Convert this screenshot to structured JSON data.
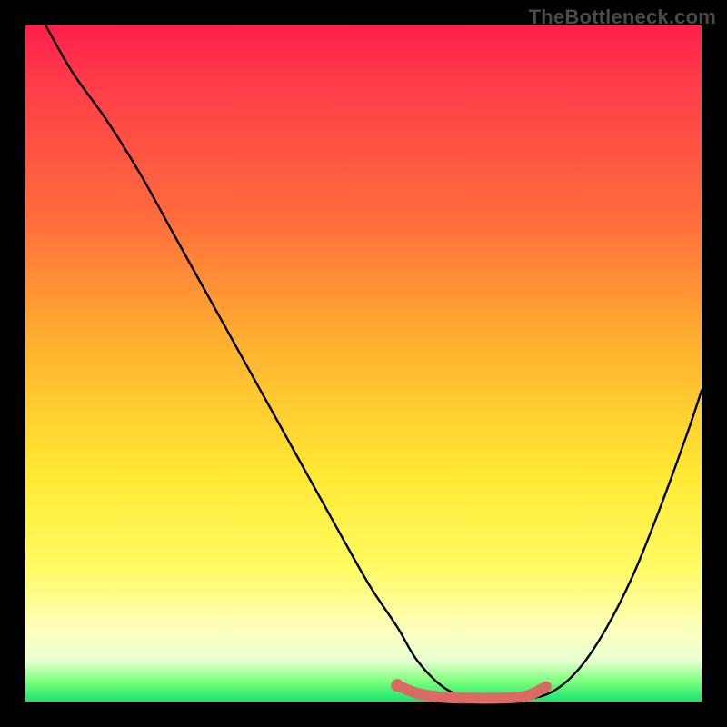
{
  "watermark": "TheBottleneck.com",
  "chart_data": {
    "type": "line",
    "title": "",
    "xlabel": "",
    "ylabel": "",
    "xlim": [
      0,
      100
    ],
    "ylim": [
      0,
      100
    ],
    "grid": false,
    "series": [
      {
        "name": "bottleneck-curve",
        "color": "#000000",
        "stroke_width": 2.4,
        "x": [
          3,
          7,
          12,
          17,
          22,
          27,
          32,
          37,
          42,
          47,
          51,
          55,
          58,
          62,
          66,
          70,
          74,
          78,
          82,
          86,
          90,
          94,
          98,
          100
        ],
        "values": [
          100,
          93,
          86,
          78,
          69,
          60,
          51,
          42,
          33,
          24,
          17,
          11,
          6,
          2,
          0.5,
          0.3,
          0.4,
          1.5,
          5,
          11,
          19,
          29,
          40,
          46
        ]
      },
      {
        "name": "highlight-segment",
        "color": "#d96a64",
        "stroke_width": 12,
        "x": [
          55,
          58,
          62,
          66,
          70,
          74,
          77
        ],
        "values": [
          2.4,
          1.2,
          0.6,
          0.5,
          0.5,
          0.8,
          2.2
        ]
      }
    ],
    "annotations": [
      {
        "name": "highlight-start-dot",
        "x": 55,
        "y": 2.4,
        "r": 7,
        "color": "#d96a64"
      }
    ]
  }
}
